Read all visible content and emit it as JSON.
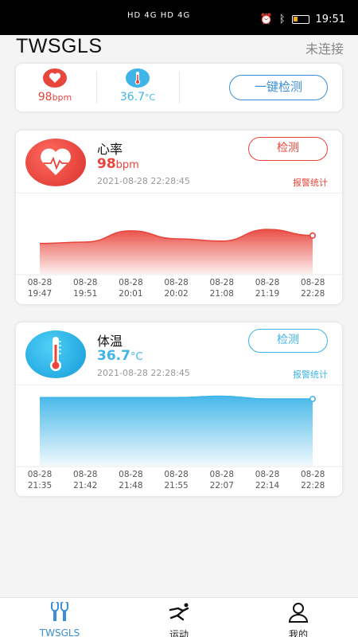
{
  "status_bar": {
    "network": "HD 4G HD 4G",
    "time": "19:51",
    "icons": [
      "signal-icon",
      "wifi-icon",
      "message-icon",
      "alarm-icon",
      "bluetooth-icon",
      "battery-icon"
    ]
  },
  "header": {
    "app_title": "TWSGLS",
    "connection_status": "未连接"
  },
  "summary": {
    "heart_value": "98",
    "heart_unit": "bpm",
    "temp_value": "36.7",
    "temp_unit": "°C",
    "one_click_label": "一键检测"
  },
  "colors": {
    "heart": "#e8453c",
    "temp": "#3fb4e8",
    "accent": "#3b8fd6"
  },
  "heart_card": {
    "title": "心率",
    "value": "98",
    "unit": "bpm",
    "timestamp": "2021-08-28 22:28:45",
    "detect_label": "检测",
    "alarm_label": "报警统计"
  },
  "temp_card": {
    "title": "体温",
    "value": "36.7",
    "unit": "°C",
    "timestamp": "2021-08-28 22:28:45",
    "detect_label": "检测",
    "alarm_label": "报警统计"
  },
  "chart_data": [
    {
      "type": "area",
      "dates": [
        "08-28",
        "08-28",
        "08-28",
        "08-28",
        "08-28",
        "08-28",
        "08-28"
      ],
      "times": [
        "19:47",
        "19:51",
        "20:01",
        "20:02",
        "21:08",
        "21:19",
        "22:28"
      ],
      "values": [
        65,
        68,
        92,
        75,
        70,
        95,
        82
      ],
      "ylim": [
        0,
        170
      ],
      "color": "#e8453c"
    },
    {
      "type": "area",
      "dates": [
        "08-28",
        "08-28",
        "08-28",
        "08-28",
        "08-28",
        "08-28",
        "08-28"
      ],
      "times": [
        "21:35",
        "21:42",
        "21:48",
        "21:55",
        "22:07",
        "22:14",
        "22:28"
      ],
      "values": [
        36.8,
        36.8,
        36.8,
        36.8,
        36.9,
        36.7,
        36.7
      ],
      "ylim": [
        32.0,
        37.6
      ],
      "color": "#3fb4e8"
    }
  ],
  "tabbar": {
    "tabs": [
      {
        "label": "TWSGLS",
        "icon": "earbuds-icon"
      },
      {
        "label": "运动",
        "icon": "runner-icon"
      },
      {
        "label": "我的",
        "icon": "person-icon"
      }
    ]
  }
}
